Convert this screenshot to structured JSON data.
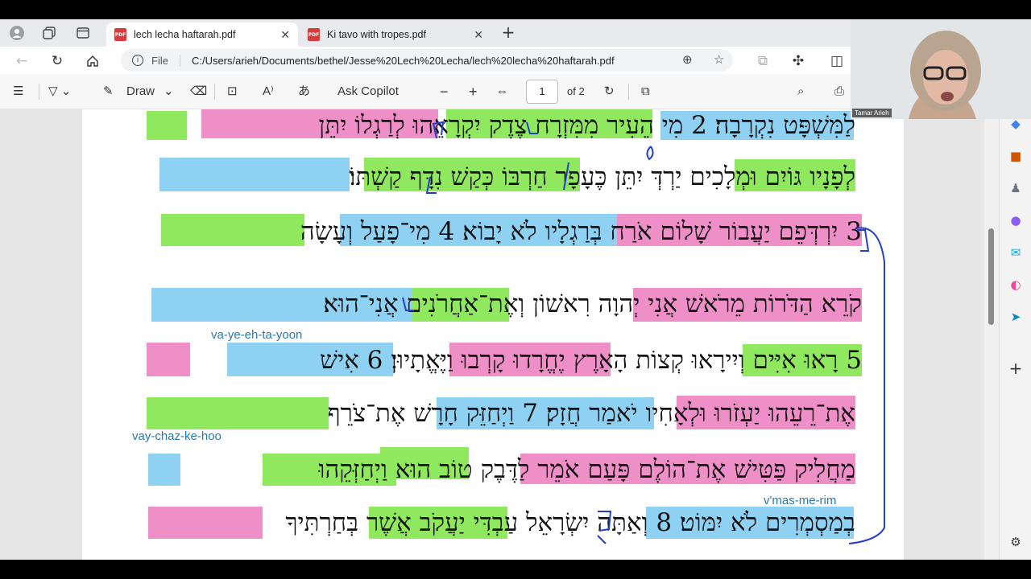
{
  "browser": {
    "tabs": [
      {
        "title": "lech lecha haftarah.pdf",
        "active": true
      },
      {
        "title": "Ki tavo with tropes.pdf",
        "active": false
      }
    ],
    "address": {
      "scheme_label": "File",
      "url": "C:/Users/arieh/Documents/bethel/Jesse%20Lech%20Lecha/lech%20lecha%20haftarah.pdf"
    }
  },
  "pdf_toolbar": {
    "draw_label": "Draw",
    "copilot_label": "Ask Copilot",
    "page_current": "1",
    "page_total": "of 2"
  },
  "document": {
    "lines": [
      "לַמִּשְׁפָּט נִקְרָבָה׃ 2 מִי הֵעִיר מִמִּזְרָח צֶדֶק יִקְרָאֵהוּ לְרַגְלוֹ יִתֵּן",
      "לְפָנָיו גּוֹיִם וּמְלָכִים יַרְדְּ יִתֵּן כֶּעָפָר חַרְבּוֹ כְּקַשׁ נִדָּף קַשְׁתּוֹ׃",
      "3 יִרְדְּפֵם יַעֲבוֹר שָׁלוֹם אֹרַח בְּרַגְלָיו לֹא יָבוֹא׃ 4 מִי־פָעַל וְעָשָׂה",
      "קֹרֵא הַדֹּרוֹת מֵרֹאשׁ אֲנִי יְהוָה רִאשׁוֹן וְאֶת־אַחֲרֹנִים אֲנִי־הוּא׃",
      "5 רָאוּ אִיִּים וְיִירָאוּ קְצוֹת הָאָרֶץ יֶחֱרָדוּ קָרְבוּ וַיֶּאֱתָיוּן׃ 6 אִישׁ",
      "אֶת־רֵעֵהוּ יַעְזֹרוּ וּלְאָחִיו יֹאמַר חֲזָק׃ 7 וַיְחַזֵּק חָרָשׁ אֶת־צֹרֵף",
      "מַחֲלִיק פַּטִּישׁ אֶת־הוֹלֶם פָּעַם אֹמֵר לַדֶּבֶק טוֹב הוּא וַיְחַזְּקֵהוּ",
      "בְמַסְמְרִים לֹא יִמּוֹט׃ 8 וְאַתָּה יִשְׂרָאֵל עַבְדִּי יַעֲקֹב אֲשֶׁר בְּחַרְתִּיךָ"
    ],
    "verse_numbers": [
      "2",
      "3",
      "4",
      "5",
      "6",
      "7",
      "8"
    ],
    "annotations": {
      "translit_1": "va-ye-eh-ta-yoon",
      "translit_2": "vay-chaz-ke-hoo",
      "translit_3": "v'mas-me-rim"
    }
  },
  "webcam": {
    "name": "Tamar Arieh"
  },
  "colors": {
    "pink": "#ef8fc8",
    "blue": "#8fd1f3",
    "green": "#8fe85e",
    "ink": "#1f3fd0"
  }
}
